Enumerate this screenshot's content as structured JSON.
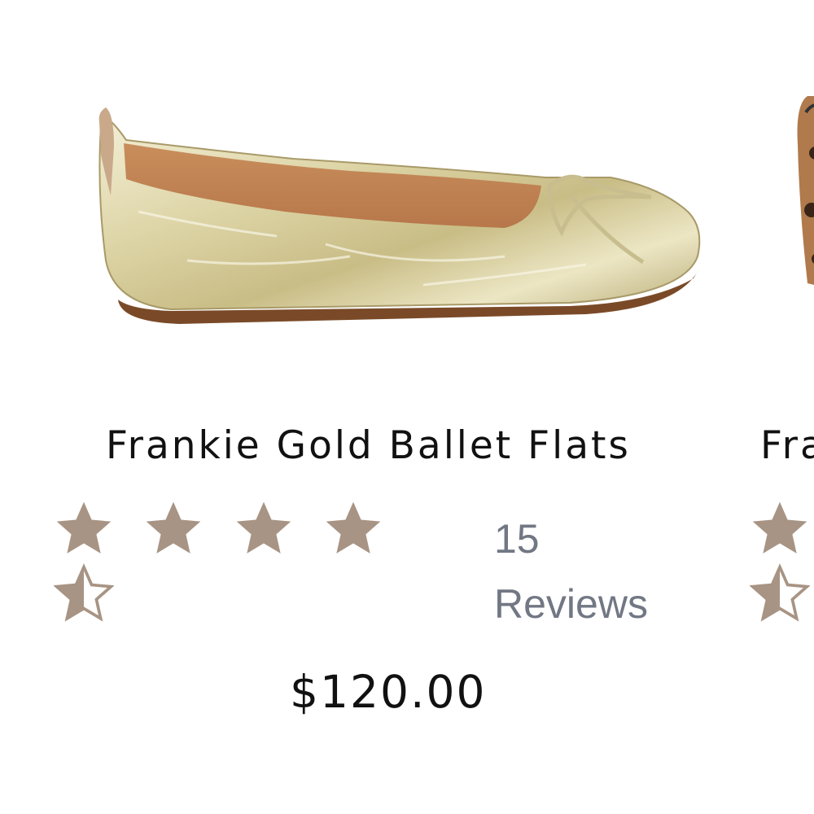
{
  "product": {
    "title": "Frankie Gold Ballet Flats",
    "rating": 4.5,
    "review_count": "15",
    "review_word": "Reviews",
    "price": "$120.00",
    "image_icon": "gold-ballet-flat-image"
  },
  "next_product": {
    "title_partial": "Fra",
    "rating": 4.5,
    "image_icon": "leopard-flat-image"
  },
  "colors": {
    "star": "#a89484",
    "review_text": "#727784",
    "text": "#111111"
  }
}
